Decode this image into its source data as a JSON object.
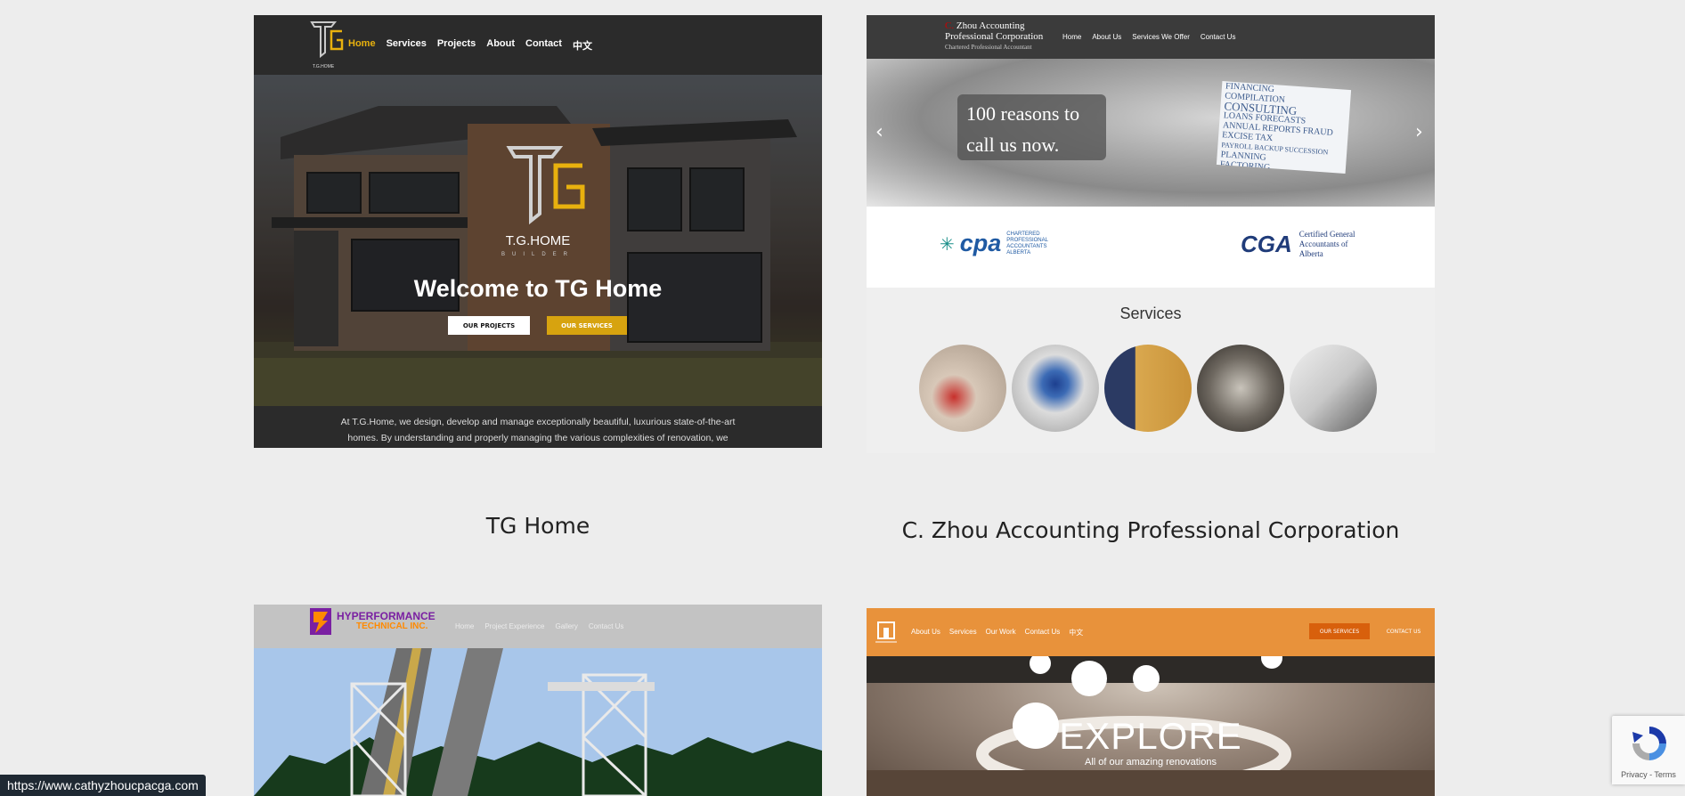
{
  "portfolio": [
    {
      "caption": "TG Home",
      "nav": [
        "Home",
        "Services",
        "Projects",
        "About",
        "Contact",
        "中文"
      ],
      "logo_text": "T.G.HOME",
      "logo_sub": "BUILDER",
      "small_logo_text": "T.G.HOME",
      "headline": "Welcome to TG Home",
      "btn_projects": "OUR PROJECTS",
      "btn_services": "OUR SERVICES",
      "blurb": "At T.G.Home, we design, develop and manage exceptionally beautiful, luxurious state-of-the-art homes. By understanding and properly managing the various complexities of renovation, we ensure that your dream house is done on time and on budget.",
      "accent_color": "#e8b10e"
    },
    {
      "caption": "C. Zhou Accounting Professional Corporation",
      "brand_line1": "Zhou Accounting",
      "brand_line2": "Professional Corporation",
      "brand_sub": "Chartered Professional Accountant",
      "nav": [
        "Home",
        "About Us",
        "Services We Offer",
        "Contact Us"
      ],
      "hero_quote": "100 reasons to call us now.",
      "card_words": [
        "FINANCING",
        "COMPILATION",
        "CONSULTING",
        "LOANS FORECASTS",
        "ANNUAL REPORTS FRAUD",
        "EXCISE TAX",
        "PAYROLL BACKUP SUCCESSION",
        "PLANNING",
        "FACTORING"
      ],
      "cpa_big": "cpa",
      "cpa_small": [
        "CHARTERED",
        "PROFESSIONAL",
        "ACCOUNTANTS",
        "ALBERTA"
      ],
      "cga_big": "CGA",
      "cga_small": [
        "Certified General",
        "Accountants of",
        "Alberta"
      ],
      "services_title": "Services",
      "service_icons": [
        "calculator-binder-icon",
        "mouse-documents-icon",
        "books-binder-icon",
        "keypad-icon",
        "laptop-phone-icon"
      ]
    },
    {
      "brand_line1": "HYPERFORMANCE",
      "brand_line2": "TECHNICAL INC.",
      "nav": [
        "Home",
        "Project Experience",
        "Gallery",
        "Contact Us"
      ]
    },
    {
      "nav": [
        "About Us",
        "Services",
        "Our Work",
        "Contact Us",
        "中文"
      ],
      "cta_services": "OUR SERVICES",
      "cta_contact": "CONTACT US",
      "headline": "EXPLORE",
      "tagline": "All of our amazing renovations",
      "accent_color": "#e8923b"
    }
  ],
  "status_url": "https://www.cathyzhoucpacga.com",
  "recaptcha_text": "Privacy - Terms"
}
